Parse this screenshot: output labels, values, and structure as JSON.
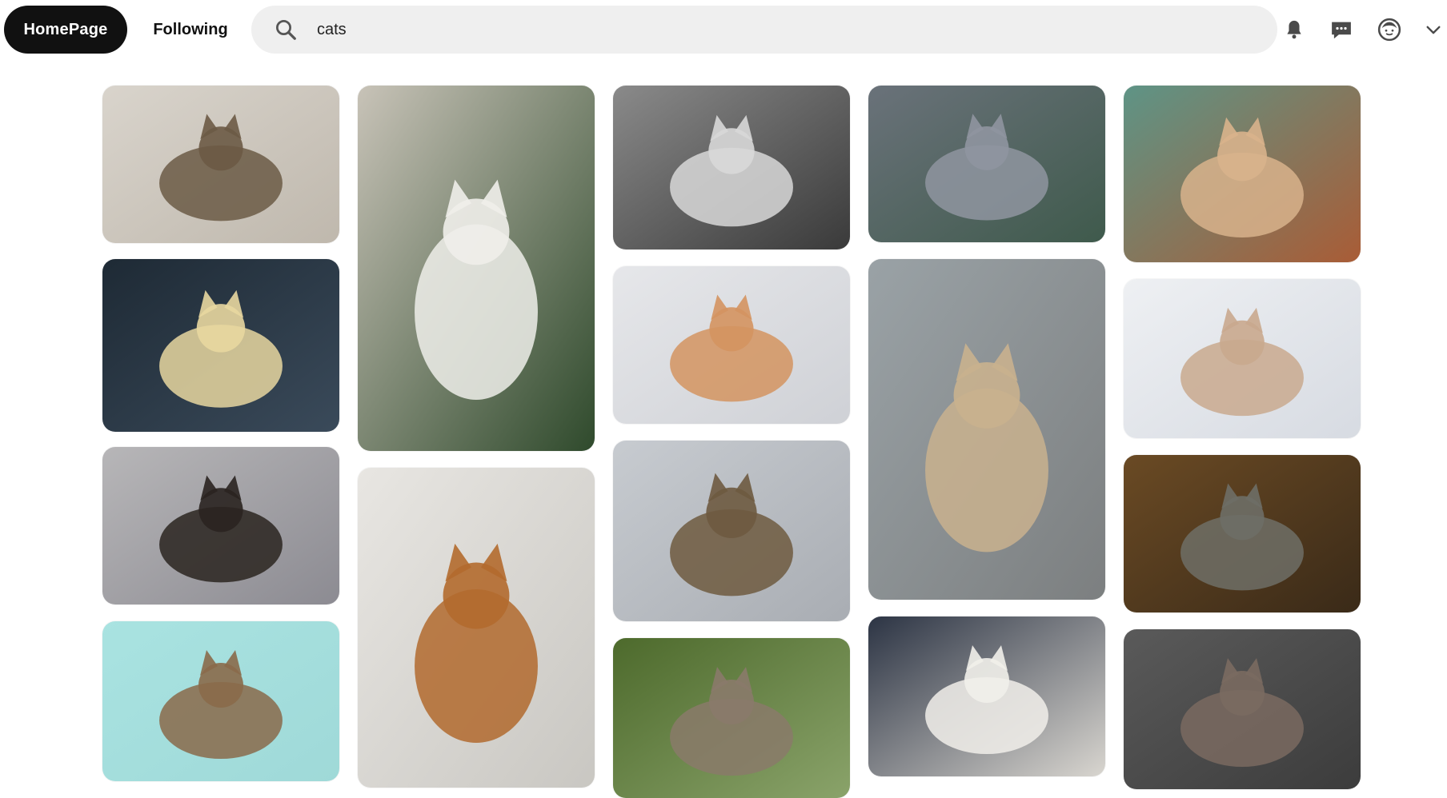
{
  "nav": {
    "home_label": "HomePage",
    "following_label": "Following"
  },
  "search": {
    "value": "cats",
    "icon": "search-icon"
  },
  "header_icons": [
    "bell-icon",
    "chat-icon",
    "profile-icon",
    "chevron-down-icon"
  ],
  "pins": [
    {
      "id": "pin-tabby-sofa",
      "colors": [
        "#d9d4cc",
        "#bfb8ad",
        "#6b5a45"
      ]
    },
    {
      "id": "pin-bokeh-cat",
      "colors": [
        "#1e2a35",
        "#3a4a5a",
        "#e8d7a0"
      ]
    },
    {
      "id": "pin-two-cats",
      "colors": [
        "#b7b6b8",
        "#8c8b92",
        "#2a2420"
      ]
    },
    {
      "id": "pin-teal-cat",
      "colors": [
        "#a9e3e1",
        "#9fd9d8",
        "#8a6a4a"
      ]
    },
    {
      "id": "pin-white-persian-plant",
      "colors": [
        "#c8c3b8",
        "#2f4a2c",
        "#efeeea"
      ]
    },
    {
      "id": "pin-ginger-sleeping",
      "colors": [
        "#e8e6e2",
        "#c9c7c2",
        "#b26a2e"
      ]
    },
    {
      "id": "pin-cat-computer",
      "colors": [
        "#8a8a8a",
        "#3a3a3a",
        "#d8d8d8"
      ]
    },
    {
      "id": "pin-yawning-cat",
      "colors": [
        "#e6e7ea",
        "#cfd1d6",
        "#d49460"
      ]
    },
    {
      "id": "pin-tabby-portrait",
      "colors": [
        "#c7cbd0",
        "#a9adb3",
        "#6e5a40"
      ]
    },
    {
      "id": "pin-kitten-tree",
      "colors": [
        "#4d6a2c",
        "#8aa36a",
        "#8a7a6a"
      ]
    },
    {
      "id": "pin-grey-licking",
      "colors": [
        "#6a727a",
        "#3f5a4c",
        "#8f95a0"
      ]
    },
    {
      "id": "pin-maine-coon",
      "colors": [
        "#9aa2a6",
        "#7c7f80",
        "#c9b18e"
      ]
    },
    {
      "id": "pin-white-cat-bed",
      "colors": [
        "#2c3444",
        "#d9d6d0",
        "#f1efea"
      ]
    },
    {
      "id": "pin-cat-upside-down",
      "colors": [
        "#5e9486",
        "#a95c36",
        "#d8b38c"
      ]
    },
    {
      "id": "pin-cat-blanket",
      "colors": [
        "#eef0f3",
        "#d7dbe2",
        "#c9a98e"
      ]
    },
    {
      "id": "pin-standing-cat",
      "colors": [
        "#6a4a24",
        "#3a2a18",
        "#6e6e66"
      ]
    },
    {
      "id": "pin-dark-grey",
      "colors": [
        "#5a5a5a",
        "#3c3c3c",
        "#7a6a60"
      ]
    }
  ]
}
